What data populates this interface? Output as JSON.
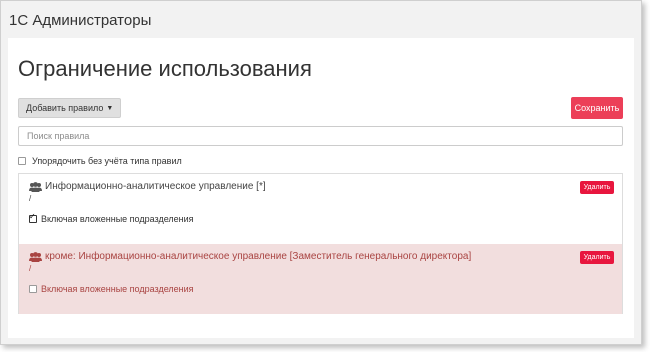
{
  "app": {
    "title": "1С Администраторы"
  },
  "page": {
    "title": "Ограничение использования"
  },
  "toolbar": {
    "add_rule_label": "Добавить правило",
    "save_label": "Сохранить"
  },
  "search": {
    "placeholder": "Поиск правила",
    "value": ""
  },
  "sort_option": {
    "label": "Упорядочить без учёта типа правил",
    "checked": false
  },
  "rules": [
    {
      "title": "Информационно-аналитическое управление [*]",
      "path": "/",
      "delete_label": "Удалить",
      "include_label": "Включая вложенные подразделения",
      "include_checked": true,
      "icon": "users-icon",
      "exception": false
    },
    {
      "title": "кроме: Информационно-аналитическое управление [Заместитель генерального директора]",
      "path": "/",
      "delete_label": "Удалить",
      "include_label": "Включая вложенные подразделения",
      "include_checked": false,
      "icon": "users-icon",
      "exception": true
    }
  ],
  "colors": {
    "save_button": "#ec3f58",
    "delete_button": "#e8163e",
    "exception_bg": "#f2dede",
    "exception_text": "#a94442"
  }
}
